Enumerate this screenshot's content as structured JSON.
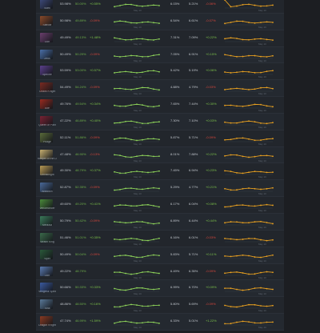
{
  "rows": [
    {
      "hero": "Slark",
      "color": "#3d4a7a",
      "wr": "53.98%",
      "pick": "50.00%",
      "change": "+0.55%",
      "change_pos": true,
      "c5": "6.03%",
      "c6": "5.21%",
      "c7": "-0.06%",
      "c7_pos": false
    },
    {
      "hero": "Slardar",
      "color": "#8a4a2a",
      "wr": "50.98%",
      "pick": "49.89%",
      "change": "-0.09%",
      "change_pos": false,
      "c5": "6.54%",
      "c6": "6.61%",
      "c7": "-0.07%",
      "c7_pos": false
    },
    {
      "hero": "Lion",
      "color": "#6b3f6e",
      "wr": "49.49%",
      "pick": "49.13%",
      "change": "+1.48%",
      "change_pos": true,
      "c5": "7.31%",
      "c6": "7.09%",
      "c7": "+0.22%",
      "c7_pos": true
    },
    {
      "hero": "Zeus",
      "color": "#4a6fa8",
      "wr": "50.49%",
      "pick": "50.29%",
      "change": "-0.09%",
      "change_pos": false,
      "c5": "7.05%",
      "c6": "6.91%",
      "c7": "+0.15%",
      "c7_pos": true
    },
    {
      "hero": "Spectre",
      "color": "#5b3f8c",
      "wr": "53.59%",
      "pick": "53.00%",
      "change": "+0.57%",
      "change_pos": true,
      "c5": "5.42%",
      "c6": "5.19%",
      "c7": "+0.06%",
      "c7_pos": true
    },
    {
      "hero": "Chaos Knight",
      "color": "#7a2a22",
      "wr": "54.49%",
      "pick": "54.24%",
      "change": "-0.09%",
      "change_pos": false,
      "c5": "4.88%",
      "c6": "4.79%",
      "c7": "-0.03%",
      "c7_pos": false
    },
    {
      "hero": "Axe",
      "color": "#9a2a20",
      "wr": "49.76%",
      "pick": "49.54%",
      "change": "+0.34%",
      "change_pos": true,
      "c5": "7.65%",
      "c6": "7.44%",
      "c7": "+0.30%",
      "c7_pos": true
    },
    {
      "hero": "Queen of Pain",
      "color": "#7a2233",
      "wr": "47.22%",
      "pick": "46.89%",
      "change": "+0.40%",
      "change_pos": true,
      "c5": "7.30%",
      "c6": "7.10%",
      "c7": "+0.03%",
      "c7_pos": true
    },
    {
      "hero": "Pudge",
      "color": "#5a6b3a",
      "wr": "52.11%",
      "pick": "51.86%",
      "change": "-0.09%",
      "change_pos": false,
      "c5": "5.87%",
      "c6": "5.71%",
      "c7": "-0.09%",
      "c7_pos": false
    },
    {
      "hero": "Keeper of the Light",
      "color": "#c8b070",
      "wr": "47.48%",
      "pick": "46.90%",
      "change": "-0.13%",
      "change_pos": false,
      "c5": "8.01%",
      "c6": "7.88%",
      "c7": "+0.22%",
      "c7_pos": true
    },
    {
      "hero": "Omniknight",
      "color": "#b89a55",
      "wr": "49.30%",
      "pick": "48.79%",
      "change": "+0.37%",
      "change_pos": true,
      "c5": "7.45%",
      "c6": "6.94%",
      "c7": "+0.23%",
      "c7_pos": true
    },
    {
      "hero": "Abaddon",
      "color": "#4a6a9a",
      "wr": "52.87%",
      "pick": "52.35%",
      "change": "-0.09%",
      "change_pos": false,
      "c5": "5.29%",
      "c6": "4.77%",
      "c7": "+0.21%",
      "c7_pos": true
    },
    {
      "hero": "Venomancer",
      "color": "#4a8a3a",
      "wr": "49.60%",
      "pick": "49.20%",
      "change": "+0.41%",
      "change_pos": true,
      "c5": "6.17%",
      "c6": "6.04%",
      "c7": "+0.08%",
      "c7_pos": true
    },
    {
      "hero": "Medusa",
      "color": "#3a7a5a",
      "wr": "50.79%",
      "pick": "50.42%",
      "change": "-0.09%",
      "change_pos": false,
      "c5": "6.89%",
      "c6": "6.44%",
      "c7": "+0.44%",
      "c7_pos": true
    },
    {
      "hero": "Wraith King",
      "color": "#3a6a4a",
      "wr": "51.46%",
      "pick": "51.01%",
      "change": "+0.35%",
      "change_pos": true,
      "c5": "6.16%",
      "c6": "6.01%",
      "c7": "-0.03%",
      "c7_pos": false
    },
    {
      "hero": "Viper",
      "color": "#2a5a3a",
      "wr": "50.49%",
      "pick": "50.04%",
      "change": "-0.09%",
      "change_pos": false,
      "c5": "5.83%",
      "c6": "5.71%",
      "c7": "+0.11%",
      "c7_pos": true
    },
    {
      "hero": "Lich",
      "color": "#5a7ab0",
      "wr": "49.22%",
      "pick": "48.79%",
      "change": "",
      "change_pos": true,
      "c5": "6.49%",
      "c6": "6.35%",
      "c7": "-0.09%",
      "c7_pos": false
    },
    {
      "hero": "Vengeful Spirit",
      "color": "#3a5aa0",
      "wr": "50.66%",
      "pick": "50.33%",
      "change": "+0.33%",
      "change_pos": true,
      "c5": "6.99%",
      "c6": "6.70%",
      "c7": "+0.09%",
      "c7_pos": true
    },
    {
      "hero": "Tusk",
      "color": "#5a7a9a",
      "wr": "48.86%",
      "pick": "48.50%",
      "change": "+0.16%",
      "change_pos": true,
      "c5": "5.80%",
      "c6": "5.69%",
      "c7": "-0.09%",
      "c7_pos": false
    },
    {
      "hero": "Dragon Knight",
      "color": "#8a3a22",
      "wr": "47.74%",
      "pick": "46.99%",
      "change": "+1.59%",
      "change_pos": true,
      "c5": "6.33%",
      "c6": "5.01%",
      "c7": "+1.22%",
      "c7_pos": true
    }
  ],
  "spark_date": "May 10"
}
